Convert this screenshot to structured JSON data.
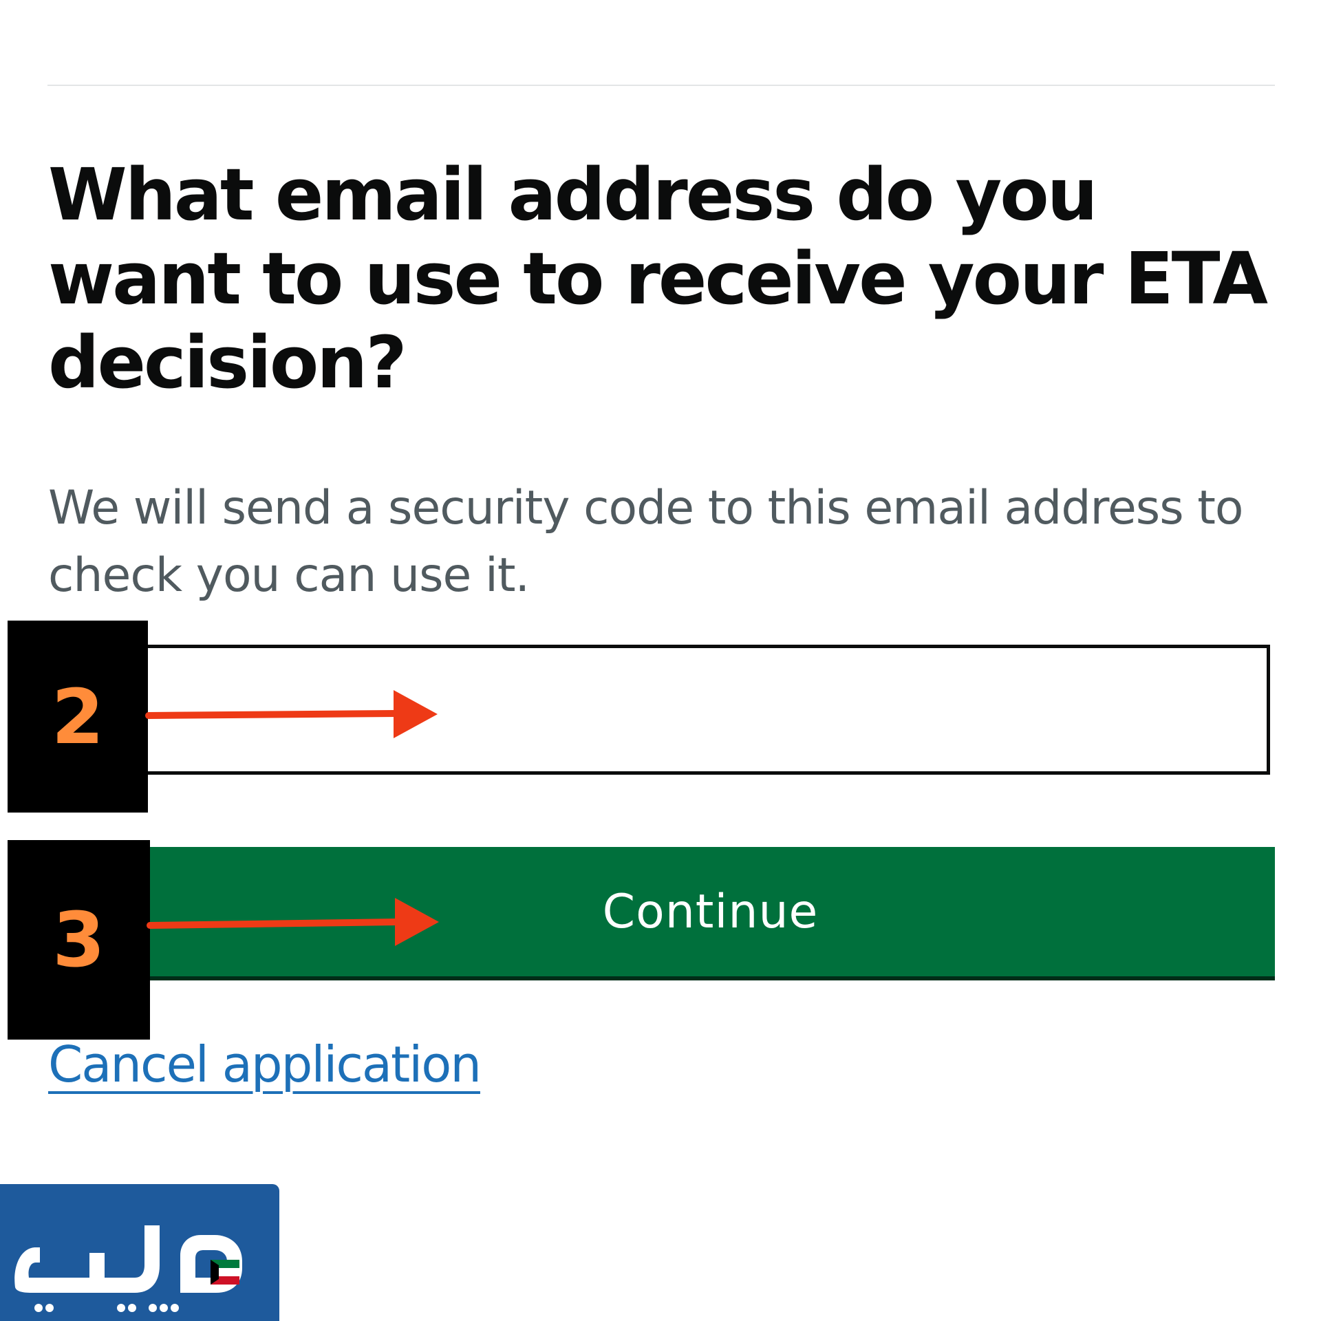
{
  "question": {
    "heading": "What email address do you want to use to receive your ETA decision?",
    "hint": "We will send a security code to this email address to check you can use it."
  },
  "email_input": {
    "value": "",
    "placeholder": ""
  },
  "actions": {
    "continue_label": "Continue",
    "cancel_link_label": "Cancel application"
  },
  "annotations": {
    "step_2_label": "2",
    "step_3_label": "3",
    "badge_text_color": "#ff8c3a",
    "arrow_color": "#ee3a16"
  },
  "logo": {
    "text": "ويكي",
    "icon": "wiki-logo-kuwait-flag"
  },
  "colors": {
    "button_green": "#00703c",
    "link_blue": "#1d70b8",
    "hint_grey": "#505a5f",
    "text_black": "#0b0c0c"
  }
}
